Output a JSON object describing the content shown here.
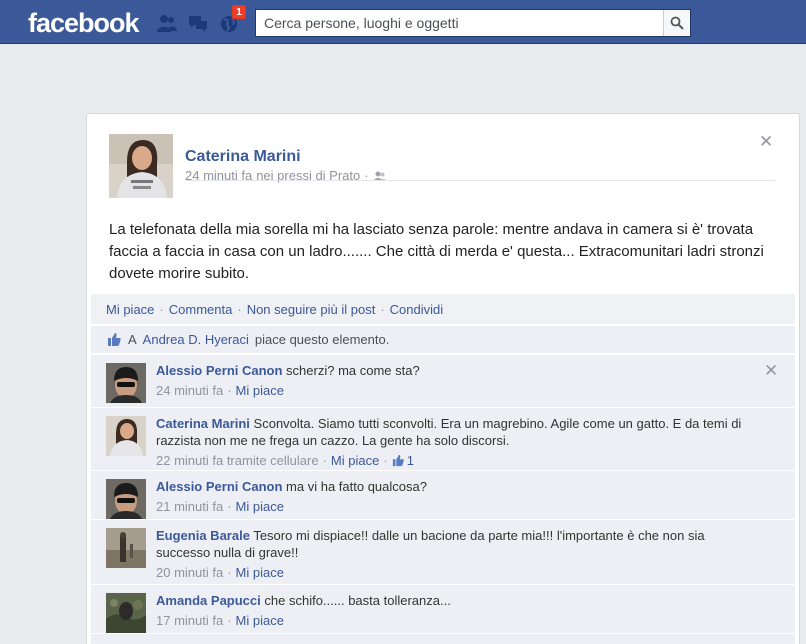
{
  "header": {
    "logo": "facebook",
    "notification_count": "1",
    "search_placeholder": "Cerca persone, luoghi e oggetti"
  },
  "post": {
    "author": "Caterina Marini",
    "time": "24 minuti fa",
    "location": "nei pressi di Prato",
    "text": "La telefonata della mia sorella mi ha lasciato senza parole: mentre andava in camera si è' trovata faccia a faccia in casa con un ladro....... Che città di merda e' questa... Extracomunitari ladri stronzi dovete morire subito.",
    "actions": [
      "Mi piace",
      "Commenta",
      "Non seguire più il post",
      "Condividi"
    ],
    "likes": {
      "prefix": "A",
      "who": "Andrea D. Hyeraci",
      "suffix": "piace questo elemento."
    }
  },
  "comments": [
    {
      "name": "Alessio Perni Canon",
      "text": "scherzi? ma come sta?",
      "time": "24 minuti fa",
      "via": "",
      "like_label": "Mi piace",
      "like_count": ""
    },
    {
      "name": "Caterina Marini",
      "text": "Sconvolta. Siamo tutti sconvolti. Era un magrebino. Agile come un gatto. E da temi di razzista non me ne frega un cazzo. La gente ha solo discorsi.",
      "time": "22 minuti fa tramite cellulare",
      "via": "",
      "like_label": "Mi piace",
      "like_count": "1"
    },
    {
      "name": "Alessio Perni Canon",
      "text": "ma vi ha fatto qualcosa?",
      "time": "21 minuti fa",
      "via": "",
      "like_label": "Mi piace",
      "like_count": ""
    },
    {
      "name": "Eugenia Barale",
      "text": "Tesoro mi dispiace!! dalle un bacione da parte mia!!! l'importante è che non sia successo nulla di grave!!",
      "time": "20 minuti fa",
      "via": "",
      "like_label": "Mi piace",
      "like_count": ""
    },
    {
      "name": "Amanda Papucci",
      "text": "che schifo...... basta tolleranza...",
      "time": "17 minuti fa",
      "via": "",
      "like_label": "Mi piace",
      "like_count": ""
    }
  ],
  "colors": {
    "brand": "#3b5998",
    "badge": "#f03d25",
    "page_bg": "#e9ebee",
    "comment_bg": "#edeff4"
  },
  "icons": [
    "friend-requests-icon",
    "messages-icon",
    "notifications-globe-icon",
    "search-icon",
    "close-icon",
    "audience-friends-icon",
    "like-thumb-icon"
  ]
}
